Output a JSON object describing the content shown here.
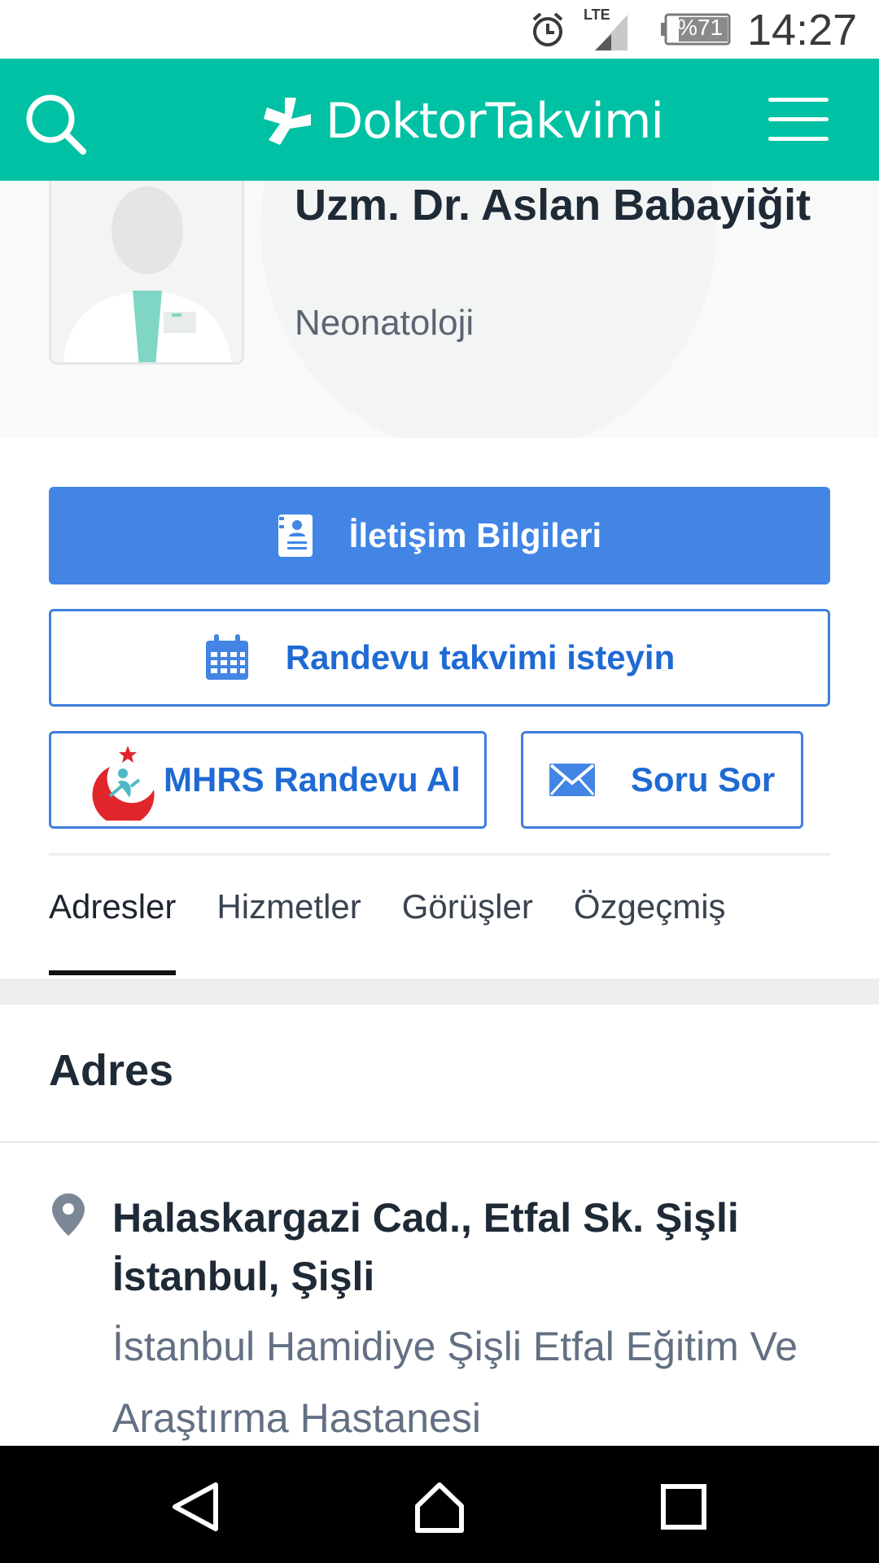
{
  "status_bar": {
    "time": "14:27",
    "battery": "%71",
    "network": "LTE"
  },
  "header": {
    "brand": "DoktorTakvimi"
  },
  "profile": {
    "name": "Uzm. Dr. Aslan Babayiğit",
    "specialty": "Neonatoloji"
  },
  "buttons": {
    "contact": "İletişim Bilgileri",
    "calendar": "Randevu takvimi isteyin",
    "mhrs": "MHRS Randevu Al",
    "ask": "Soru Sor"
  },
  "tabs": [
    "Adresler",
    "Hizmetler",
    "Görüşler",
    "Özgeçmiş"
  ],
  "address": {
    "title": "Adres",
    "line": "Halaskargazi Cad., Etfal Sk. Şişli İstanbul, Şişli",
    "hospital": "İstanbul Hamidiye Şişli Etfal Eğitim Ve Araştırma Hastanesi"
  },
  "colors": {
    "brand": "#00c1a3",
    "primary": "#4285e4",
    "outline": "#3d7fdc"
  }
}
